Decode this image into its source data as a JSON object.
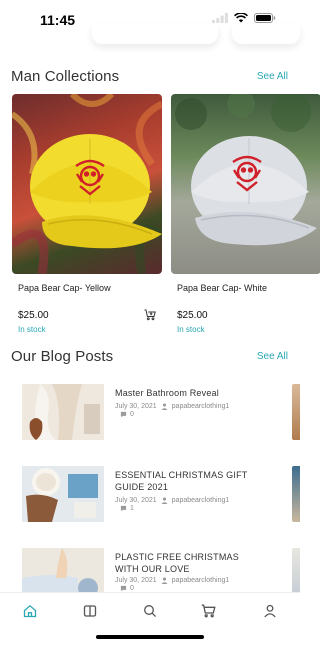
{
  "status_bar": {
    "time": "11:45"
  },
  "collections": {
    "title": "Man Collections",
    "see_all": "See All",
    "products": [
      {
        "name": "Papa Bear Cap- Yellow",
        "price": "$25.00",
        "stock": "In stock",
        "cap_color": "#f2dc2e"
      },
      {
        "name": "Papa Bear Cap- White",
        "price": "$25.00",
        "stock": "In stock",
        "cap_color": "#dcdfe4"
      }
    ]
  },
  "blog": {
    "title": "Our Blog Posts",
    "see_all": "See All",
    "posts": [
      {
        "title": "Master Bathroom Reveal",
        "date": "July 30, 2021",
        "author": "papabearclothing1",
        "comments": "0"
      },
      {
        "title": "ESSENTIAL CHRISTMAS GIFT GUIDE 2021",
        "date": "July 30, 2021",
        "author": "papabearclothing1",
        "comments": "1"
      },
      {
        "title": "PLASTIC FREE CHRISTMAS WITH OUR LOVE",
        "date": "July 30, 2021",
        "author": "papabearclothing1",
        "comments": "0"
      }
    ]
  },
  "tab_bar": {
    "tabs": [
      "home-icon",
      "book-icon",
      "search-icon",
      "cart-icon",
      "profile-icon"
    ],
    "active_color": "#2aa7b3",
    "inactive_color": "#555555"
  },
  "colors": {
    "accent": "#2aa7b3",
    "logo_red": "#d0202a"
  }
}
